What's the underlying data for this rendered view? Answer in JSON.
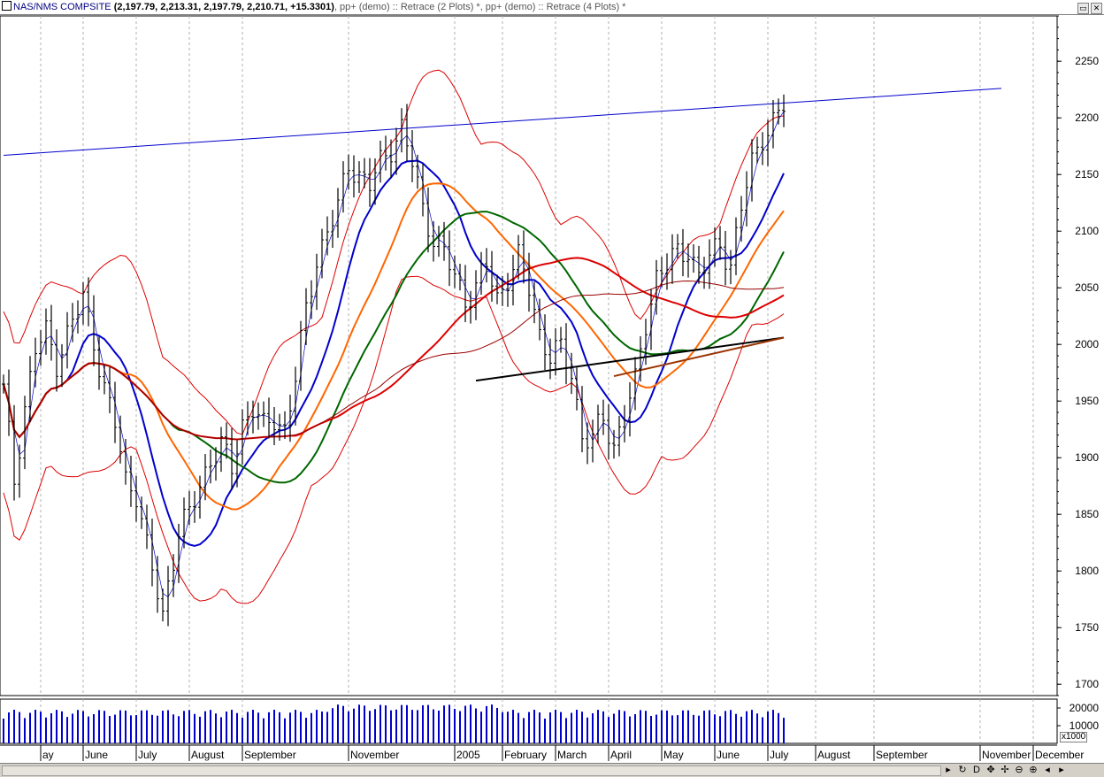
{
  "window": {
    "symbol": "NAS/NMS COMPSITE",
    "values": "(2,197.79, 2,213.31, 2,197.79, 2,210.71, +15.3301)",
    "studies": ", pp+ (demo) :: Retrace (2 Plots) *, pp+ (demo) :: Retrace (4 Plots) *",
    "buttons": [
      "▭",
      "✕"
    ]
  },
  "statusbar": {
    "icons": [
      {
        "name": "scroll-right-icon",
        "glyph": "▸"
      },
      {
        "name": "refresh-icon",
        "glyph": "↻"
      },
      {
        "name": "daily-icon",
        "glyph": "D"
      },
      {
        "name": "crosshair-icon",
        "glyph": "✥"
      },
      {
        "name": "pan-icon",
        "glyph": "✢"
      },
      {
        "name": "zoom-out-icon",
        "glyph": "⊖"
      },
      {
        "name": "zoom-in-icon",
        "glyph": "⊕"
      },
      {
        "name": "prev-icon",
        "glyph": "◂"
      },
      {
        "name": "next-icon",
        "glyph": "▸"
      }
    ]
  },
  "chart_data": {
    "type": "ohlc",
    "symbol": "NAS/NMS COMPSITE",
    "period": "weekly-ish daily bars, May 2004 – July 2005",
    "ylim": [
      1690,
      2290
    ],
    "y_ticks": [
      1700,
      1750,
      1800,
      1850,
      1900,
      1950,
      2000,
      2050,
      2100,
      2150,
      2200,
      2250
    ],
    "x_months": [
      {
        "label": "ay",
        "idx": 0
      },
      {
        "label": "June",
        "idx": 8
      },
      {
        "label": "July",
        "idx": 18
      },
      {
        "label": "August",
        "idx": 28
      },
      {
        "label": "September",
        "idx": 38
      },
      {
        "label": "November",
        "idx": 58
      },
      {
        "label": "2005",
        "idx": 78
      },
      {
        "label": "February",
        "idx": 87
      },
      {
        "label": "March",
        "idx": 97
      },
      {
        "label": "April",
        "idx": 107
      },
      {
        "label": "May",
        "idx": 117
      },
      {
        "label": "June",
        "idx": 127
      },
      {
        "label": "July",
        "idx": 137
      },
      {
        "label": "August",
        "idx": 146
      },
      {
        "label": "September",
        "idx": 157
      },
      {
        "label": "November",
        "idx": 177
      },
      {
        "label": "December",
        "idx": 187
      }
    ],
    "volume_ticks": [
      {
        "label": "20000",
        "v": 20000
      },
      {
        "label": "10000",
        "v": 10000
      }
    ],
    "volume_unit": "x1000",
    "volume_max": 25000,
    "close_anchors": [
      [
        0,
        1960
      ],
      [
        2,
        1880
      ],
      [
        4,
        1945
      ],
      [
        6,
        1995
      ],
      [
        8,
        2010
      ],
      [
        10,
        1985
      ],
      [
        13,
        2020
      ],
      [
        15,
        2040
      ],
      [
        17,
        2005
      ],
      [
        19,
        1960
      ],
      [
        21,
        1930
      ],
      [
        23,
        1880
      ],
      [
        25,
        1870
      ],
      [
        27,
        1820
      ],
      [
        29,
        1780
      ],
      [
        30,
        1760
      ],
      [
        31,
        1790
      ],
      [
        33,
        1835
      ],
      [
        35,
        1850
      ],
      [
        37,
        1875
      ],
      [
        39,
        1900
      ],
      [
        41,
        1910
      ],
      [
        43,
        1890
      ],
      [
        45,
        1930
      ],
      [
        47,
        1945
      ],
      [
        49,
        1925
      ],
      [
        51,
        1935
      ],
      [
        53,
        1925
      ],
      [
        55,
        1970
      ],
      [
        57,
        2030
      ],
      [
        59,
        2075
      ],
      [
        61,
        2100
      ],
      [
        63,
        2120
      ],
      [
        65,
        2160
      ],
      [
        67,
        2150
      ],
      [
        69,
        2140
      ],
      [
        71,
        2160
      ],
      [
        73,
        2175
      ],
      [
        75,
        2190
      ],
      [
        77,
        2160
      ],
      [
        79,
        2120
      ],
      [
        81,
        2095
      ],
      [
        83,
        2080
      ],
      [
        85,
        2060
      ],
      [
        87,
        2040
      ],
      [
        89,
        2050
      ],
      [
        91,
        2070
      ],
      [
        93,
        2040
      ],
      [
        95,
        2060
      ],
      [
        97,
        2075
      ],
      [
        99,
        2050
      ],
      [
        101,
        2010
      ],
      [
        103,
        1990
      ],
      [
        105,
        1995
      ],
      [
        107,
        1975
      ],
      [
        109,
        1920
      ],
      [
        111,
        1915
      ],
      [
        113,
        1935
      ],
      [
        115,
        1910
      ],
      [
        117,
        1940
      ],
      [
        119,
        1965
      ],
      [
        121,
        2020
      ],
      [
        123,
        2060
      ],
      [
        125,
        2070
      ],
      [
        127,
        2080
      ],
      [
        129,
        2085
      ],
      [
        131,
        2060
      ],
      [
        133,
        2075
      ],
      [
        135,
        2090
      ],
      [
        137,
        2070
      ],
      [
        139,
        2120
      ],
      [
        141,
        2160
      ],
      [
        143,
        2185
      ],
      [
        145,
        2195
      ],
      [
        147,
        2210
      ]
    ],
    "bollinger_width": 80,
    "trendline": {
      "from": [
        0,
        2167
      ],
      "to": [
        188,
        2226
      ],
      "color": "#0000cc"
    },
    "ma_lines": [
      {
        "name": "ma-short",
        "color": "#0000cc",
        "width": 0.7,
        "window": 3
      },
      {
        "name": "ma-medium",
        "color": "#0000cc",
        "width": 2,
        "window": 12
      },
      {
        "name": "ma-orange",
        "color": "#ff6600",
        "width": 2,
        "window": 22
      },
      {
        "name": "ma-green",
        "color": "#006600",
        "width": 2,
        "window": 32
      },
      {
        "name": "ma-red",
        "color": "#dd0000",
        "width": 2,
        "window": 55
      },
      {
        "name": "ma-brown",
        "color": "#990000",
        "width": 1,
        "window": 70
      }
    ],
    "retrace_lines": [
      {
        "from": [
          89,
          1968
        ],
        "to": [
          147,
          2006
        ],
        "color": "#000000",
        "width": 2
      },
      {
        "from": [
          115,
          1972
        ],
        "to": [
          147,
          2006
        ],
        "color": "#993300",
        "width": 2
      }
    ],
    "colors": {
      "bars": "#000000",
      "bands": "#dd0000",
      "volume": "#0000cc",
      "grid": "#b0b0b0"
    }
  }
}
